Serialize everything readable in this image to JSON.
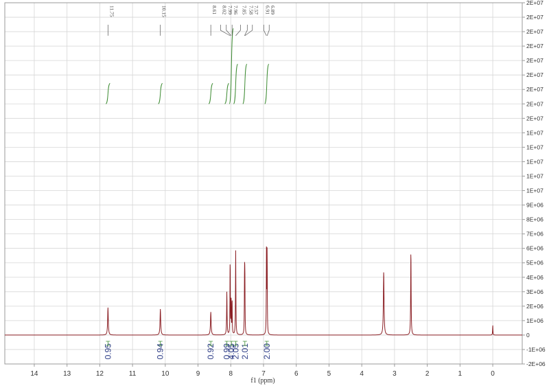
{
  "chart_data": {
    "type": "line",
    "title": "",
    "xlabel": "f1 (ppm)",
    "ylabel": "",
    "xlim": [
      14.9,
      -0.9
    ],
    "ylim": [
      -2000000,
      23000000
    ],
    "x_reversed": true,
    "grid": true,
    "x_ticks": [
      14,
      13,
      12,
      11,
      10,
      9,
      8,
      7,
      6,
      5,
      4,
      3,
      2,
      1,
      0
    ],
    "x_tick_labels": [
      "14",
      "13",
      "12",
      "11",
      "10",
      "9",
      "8",
      "7",
      "6",
      "5",
      "4",
      "3",
      "2",
      "1",
      "0"
    ],
    "y_ticks": [
      -2000000,
      -1000000,
      0,
      1000000,
      2000000,
      3000000,
      4000000,
      5000000,
      6000000,
      7000000,
      8000000,
      9000000,
      10000000,
      11000000,
      12000000,
      13000000,
      14000000,
      15000000,
      16000000,
      17000000,
      18000000,
      19000000,
      20000000,
      21000000,
      22000000,
      23000000
    ],
    "y_tick_labels": [
      "-2E+06",
      "-1E+06",
      "0",
      "1E+06",
      "2E+06",
      "3E+06",
      "4E+06",
      "5E+06",
      "6E+06",
      "7E+06",
      "8E+06",
      "9E+06",
      "1E+07",
      "1E+07",
      "1E+07",
      "1E+07",
      "1E+07",
      "2E+07",
      "2E+07",
      "2E+07",
      "2E+07",
      "2E+07",
      "2E+07",
      "2E+07",
      "2E+07",
      "2E+07"
    ],
    "series": [
      {
        "color": "#8b1f24",
        "peaks": [
          {
            "ppm": 11.75,
            "height": 1900000,
            "width": 0.012
          },
          {
            "ppm": 10.15,
            "height": 1800000,
            "width": 0.012
          },
          {
            "ppm": 8.61,
            "height": 1600000,
            "width": 0.012
          },
          {
            "ppm": 8.12,
            "height": 3000000,
            "width": 0.008
          },
          {
            "ppm": 8.02,
            "height": 5300000,
            "width": 0.006
          },
          {
            "ppm": 7.99,
            "height": 2600000,
            "width": 0.006
          },
          {
            "ppm": 7.96,
            "height": 2500000,
            "width": 0.006
          },
          {
            "ppm": 7.85,
            "height": 5900000,
            "width": 0.007
          },
          {
            "ppm": 7.58,
            "height": 4100000,
            "width": 0.006
          },
          {
            "ppm": 7.57,
            "height": 3900000,
            "width": 0.006
          },
          {
            "ppm": 6.91,
            "height": 5900000,
            "width": 0.006
          },
          {
            "ppm": 6.89,
            "height": 5800000,
            "width": 0.006
          },
          {
            "ppm": 3.33,
            "height": 4400000,
            "width": 0.012
          },
          {
            "ppm": 2.5,
            "height": 5900000,
            "width": 0.008
          },
          {
            "ppm": 0.0,
            "height": 700000,
            "width": 0.006
          }
        ]
      }
    ],
    "peak_labels": [
      "11.75",
      "10.15",
      "8.61",
      "8.02",
      "7.99",
      "7.96",
      "7.85",
      "7.58",
      "7.57",
      "6.91",
      "6.89"
    ],
    "integrals": [
      {
        "center": 11.75,
        "value": "0.95"
      },
      {
        "center": 10.15,
        "value": "0.94"
      },
      {
        "center": 8.61,
        "value": "0.92"
      },
      {
        "center": 8.12,
        "value": "0.99"
      },
      {
        "center": 7.98,
        "value": "4.05"
      },
      {
        "center": 7.85,
        "value": "2.05"
      },
      {
        "center": 7.57,
        "value": "2.01"
      },
      {
        "center": 6.9,
        "value": "2.00"
      }
    ]
  }
}
